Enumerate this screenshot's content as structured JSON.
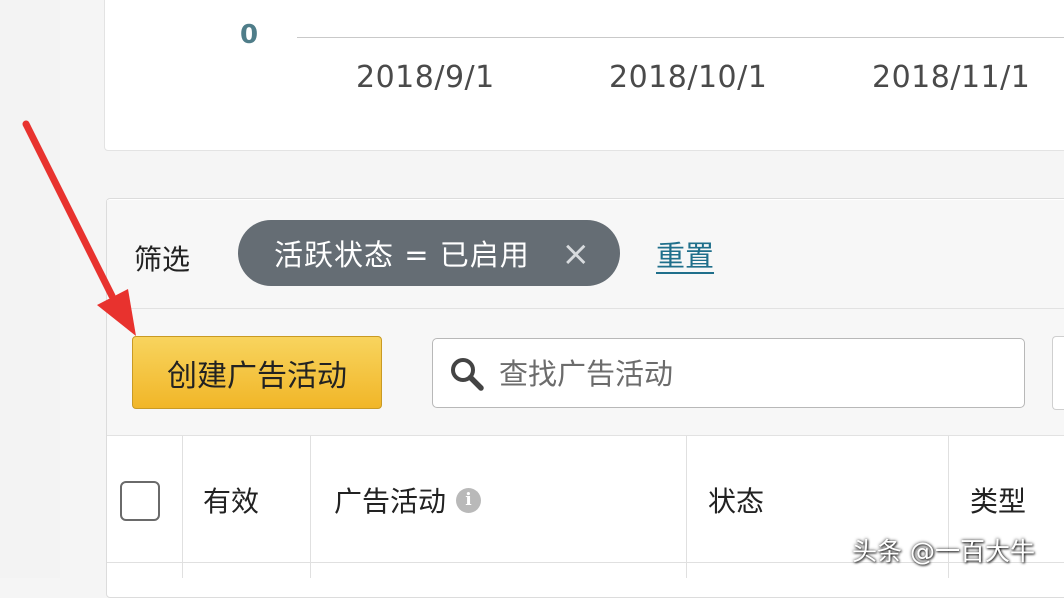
{
  "chart": {
    "zero_label": "0",
    "x_ticks": [
      "2018/9/1",
      "2018/10/1",
      "2018/11/1"
    ]
  },
  "filter": {
    "label": "筛选",
    "chip_text": "活跃状态 = 已启用",
    "chip_close": "×",
    "reset": "重置"
  },
  "toolbar": {
    "create_label": "创建广告活动",
    "search_placeholder": "查找广告活动"
  },
  "table": {
    "headers": [
      "有效",
      "广告活动",
      "状态",
      "类型"
    ]
  },
  "watermark": "头条 @一百大牛",
  "colors": {
    "accent_button": "#f1b628",
    "chip_bg": "#656d74",
    "link": "#1f6f8b",
    "arrow": "#e8322e"
  }
}
